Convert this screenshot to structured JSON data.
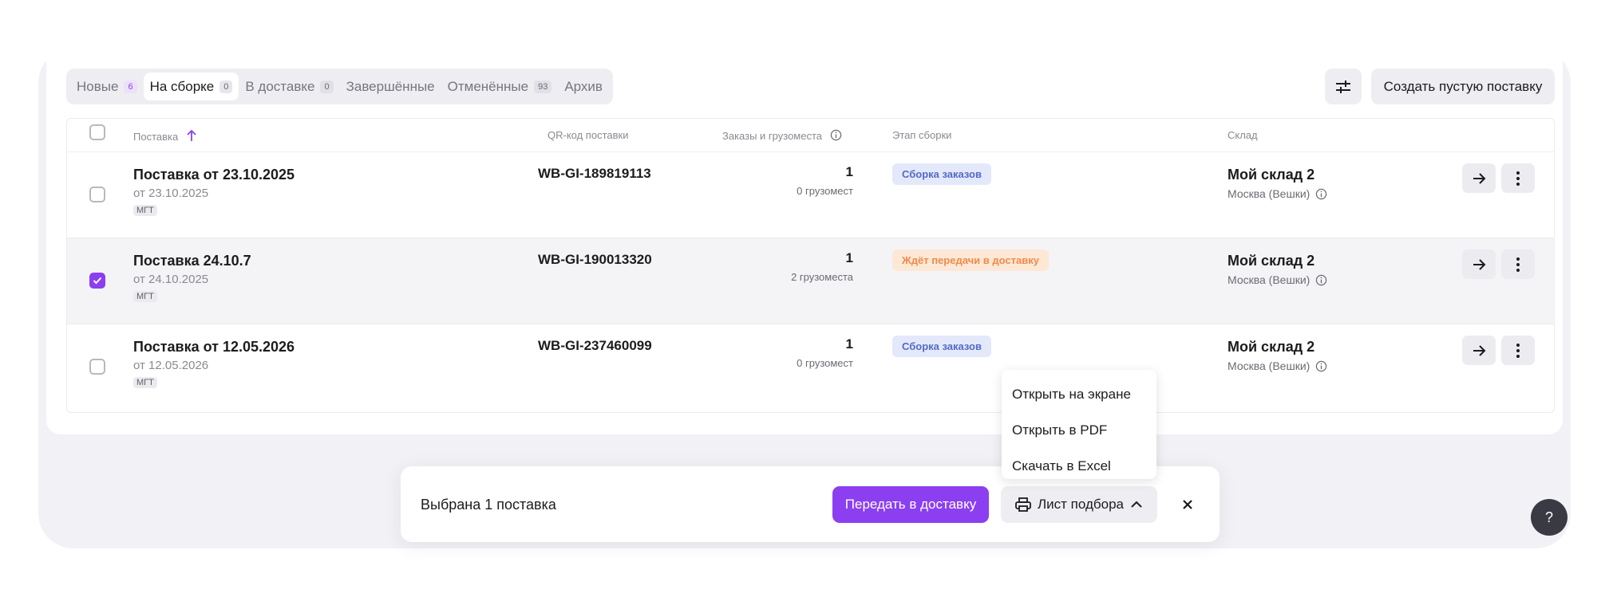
{
  "tabs": [
    {
      "label": "Новые",
      "count": "6"
    },
    {
      "label": "На сборке",
      "count": "0"
    },
    {
      "label": "В доставке",
      "count": "0"
    },
    {
      "label": "Завершённые"
    },
    {
      "label": "Отменённые",
      "count": "93"
    },
    {
      "label": "Архив"
    }
  ],
  "toolbar": {
    "filter_icon": "sliders-icon",
    "create_label": "Создать пустую поставку"
  },
  "table": {
    "headers": {
      "supply": "Поставка",
      "qr": "QR-код поставки",
      "orders": "Заказы и грузоместа",
      "stage": "Этап сборки",
      "warehouse": "Склад"
    },
    "rows": [
      {
        "title": "Поставка от 23.10.2025",
        "date": "от 23.10.2025",
        "tag": "МГТ",
        "qr": "WB-GI-189819113",
        "orders": "1",
        "cargo": "0 грузомест",
        "status": "Сборка заказов",
        "warehouse": "Мой склад 2",
        "city": "Москва (Вешки)",
        "checked": false
      },
      {
        "title": "Поставка 24.10.7",
        "date": "от 24.10.2025",
        "tag": "МГТ",
        "qr": "WB-GI-190013320",
        "orders": "1",
        "cargo": "2 грузоместа",
        "status": "Ждёт передачи в доставку",
        "warehouse": "Мой склад 2",
        "city": "Москва (Вешки)",
        "checked": true
      },
      {
        "title": "Поставка от 12.05.2026",
        "date": "от 12.05.2026",
        "tag": "МГТ",
        "qr": "WB-GI-237460099",
        "orders": "1",
        "cargo": "0 грузомест",
        "status": "Сборка заказов",
        "warehouse": "Мой склад 2",
        "city": "Москва (Вешки)",
        "checked": false
      }
    ]
  },
  "menu": {
    "items": [
      "Открыть на экране",
      "Открыть в PDF",
      "Скачать в Excel"
    ]
  },
  "bottombar": {
    "selection_text": "Выбрана 1 поставка",
    "transfer_label": "Передать в доставку",
    "picklist_label": "Лист подбора"
  },
  "help_label": "?",
  "colors": {
    "accent": "#8b3ff0",
    "status_blue_bg": "#e3e9fb",
    "status_orange_bg": "#fde8d6"
  }
}
